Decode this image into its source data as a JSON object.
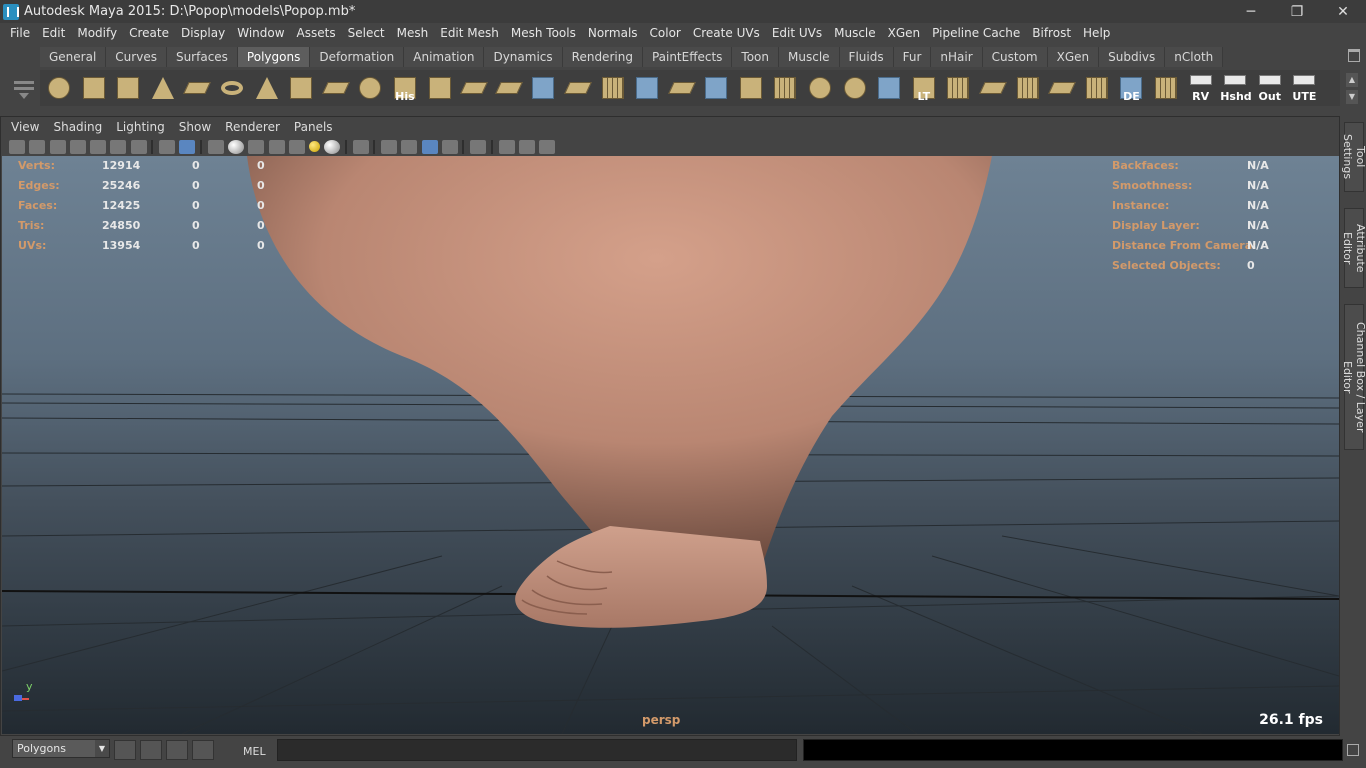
{
  "window": {
    "title": "Autodesk Maya 2015: D:\\Popop\\models\\Popop.mb*",
    "minimize": "─",
    "maximize": "❐",
    "close": "✕"
  },
  "menubar": [
    "File",
    "Edit",
    "Modify",
    "Create",
    "Display",
    "Window",
    "Assets",
    "Select",
    "Mesh",
    "Edit Mesh",
    "Mesh Tools",
    "Normals",
    "Color",
    "Create UVs",
    "Edit UVs",
    "Muscle",
    "XGen",
    "Pipeline Cache",
    "Bifrost",
    "Help"
  ],
  "shelf": {
    "tabs": [
      "General",
      "Curves",
      "Surfaces",
      "Polygons",
      "Deformation",
      "Animation",
      "Dynamics",
      "Rendering",
      "PaintEffects",
      "Toon",
      "Muscle",
      "Fluids",
      "Fur",
      "nHair",
      "Custom",
      "XGen",
      "Subdivs",
      "nCloth"
    ],
    "active_tab": "Polygons",
    "icon_labels": {
      "his": "His",
      "lt": "LT",
      "de": "DE",
      "rv": "RV",
      "hshd": "Hshd",
      "out": "Out",
      "ute": "UTE"
    }
  },
  "panel": {
    "menu": [
      "View",
      "Shading",
      "Lighting",
      "Show",
      "Renderer",
      "Panels"
    ],
    "camera": "persp",
    "fps": "26.1 fps",
    "axis_label": "y"
  },
  "hud_left": [
    {
      "label": "Verts:",
      "v1": "12914",
      "v2": "0",
      "v3": "0"
    },
    {
      "label": "Edges:",
      "v1": "25246",
      "v2": "0",
      "v3": "0"
    },
    {
      "label": "Faces:",
      "v1": "12425",
      "v2": "0",
      "v3": "0"
    },
    {
      "label": "Tris:",
      "v1": "24850",
      "v2": "0",
      "v3": "0"
    },
    {
      "label": "UVs:",
      "v1": "13954",
      "v2": "0",
      "v3": "0"
    }
  ],
  "hud_right": [
    {
      "label": "Backfaces:",
      "value": "N/A"
    },
    {
      "label": "Smoothness:",
      "value": "N/A"
    },
    {
      "label": "Instance:",
      "value": "N/A"
    },
    {
      "label": "Display Layer:",
      "value": "N/A"
    },
    {
      "label": "Distance From Camera:",
      "value": "N/A"
    },
    {
      "label": "Selected Objects:",
      "value": "0"
    }
  ],
  "side_tabs": [
    "Tool Settings",
    "Attribute Editor",
    "Channel Box / Layer Editor"
  ],
  "cmdbar": {
    "mode": "Polygons",
    "mel_label": "MEL"
  },
  "colors": {
    "skin": "#c7917b",
    "hud_label": "#d39a6a",
    "active_tab": "#5d5d5d"
  }
}
